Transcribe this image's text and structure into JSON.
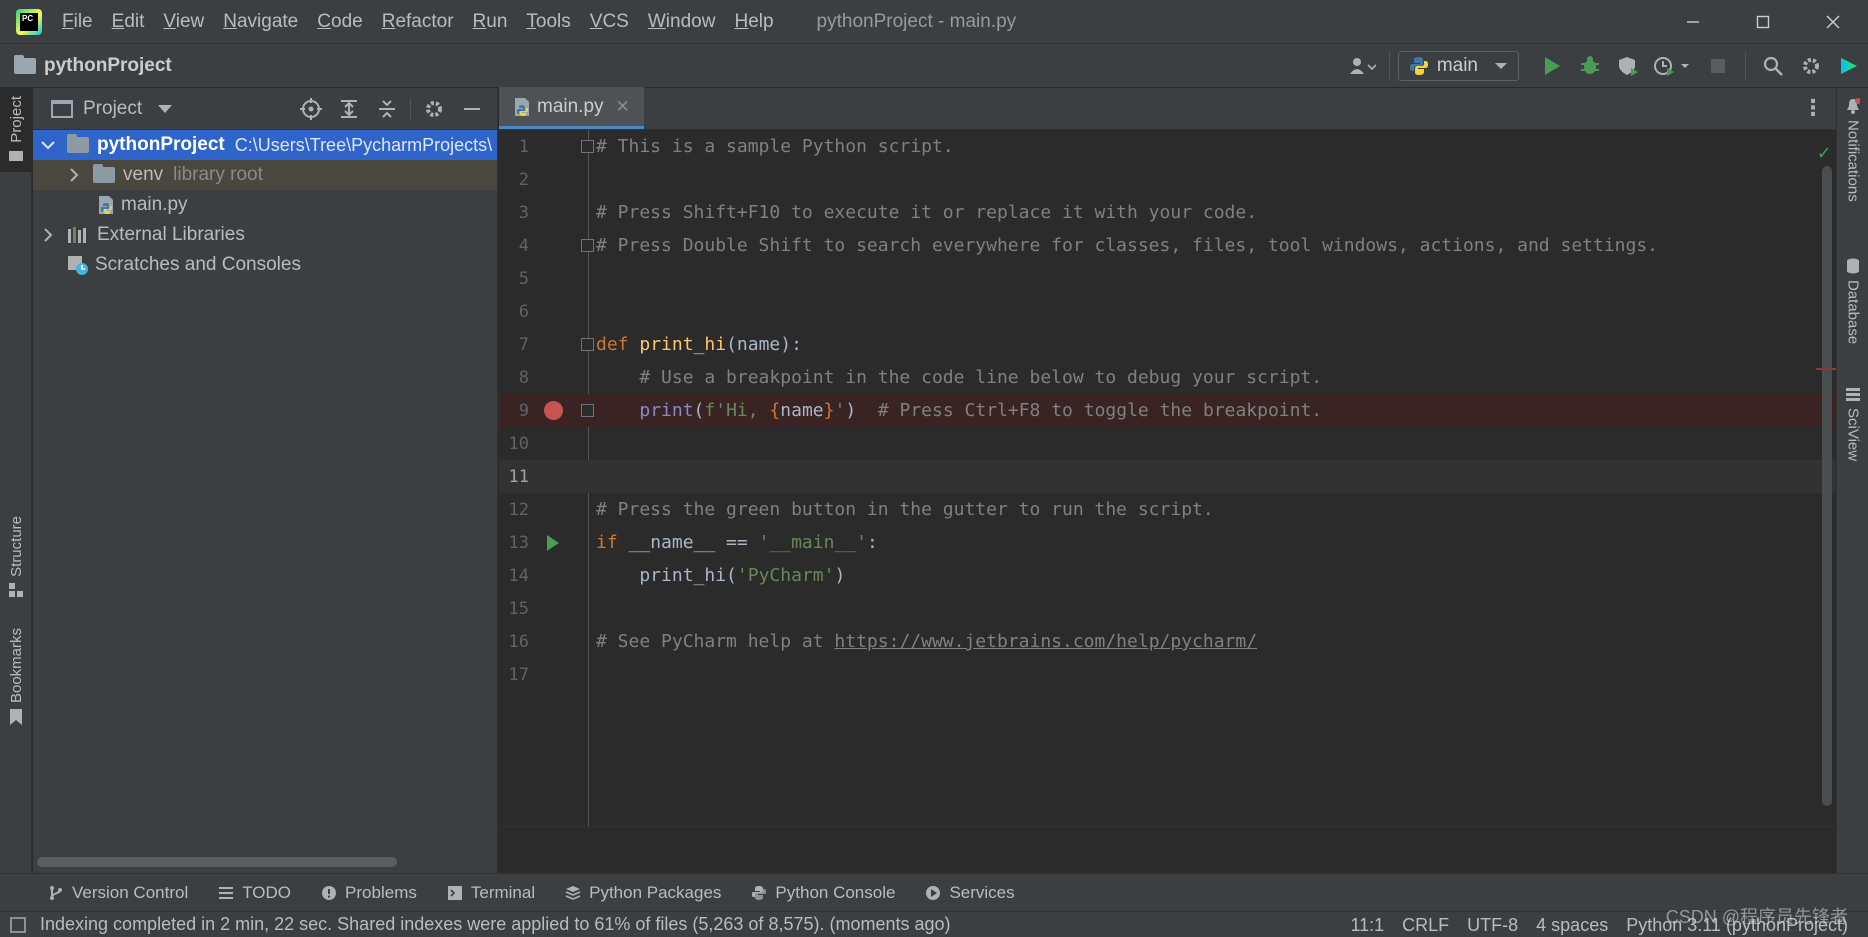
{
  "titlebar": {
    "menus": [
      "File",
      "Edit",
      "View",
      "Navigate",
      "Code",
      "Refactor",
      "Run",
      "Tools",
      "VCS",
      "Window",
      "Help"
    ],
    "window_title": "pythonProject - main.py",
    "logo_text": "PC"
  },
  "navbar": {
    "project": "pythonProject",
    "run_config": "main"
  },
  "left_stripe": {
    "project": "Project",
    "structure": "Structure",
    "bookmarks": "Bookmarks"
  },
  "right_stripe": {
    "notifications": "Notifications",
    "database": "Database",
    "sciview": "SciView"
  },
  "project_panel": {
    "title": "Project",
    "tree": [
      {
        "label": "pythonProject",
        "extra": "C:\\Users\\Tree\\PycharmProjects\\"
      },
      {
        "label": "venv",
        "extra": "library root"
      },
      {
        "label": "main.py"
      },
      {
        "label": "External Libraries"
      },
      {
        "label": "Scratches and Consoles"
      }
    ]
  },
  "editor": {
    "tab": "main.py",
    "lines": [
      {
        "n": "1",
        "text": "# This is a sample Python script."
      },
      {
        "n": "2",
        "text": ""
      },
      {
        "n": "3",
        "text": "# Press Shift+F10 to execute it or replace it with your code."
      },
      {
        "n": "4",
        "text": "# Press Double Shift to search everywhere for classes, files, tool windows, actions, and settings."
      },
      {
        "n": "5",
        "text": ""
      },
      {
        "n": "6",
        "text": ""
      },
      {
        "n": "7",
        "kw": "def",
        "fn": "print_hi",
        "rest": "(name):"
      },
      {
        "n": "8",
        "text": "    # Use a breakpoint in the code line below to debug your script."
      },
      {
        "n": "9",
        "indent": "    ",
        "builtin": "print",
        "p1": "(",
        "s1": "f'Hi, ",
        "b1": "{",
        "var": "name",
        "b2": "}",
        "s2": "'",
        "p2": ")",
        "comment": "  # Press Ctrl+F8 to toggle the breakpoint."
      },
      {
        "n": "10",
        "text": ""
      },
      {
        "n": "11",
        "text": ""
      },
      {
        "n": "12",
        "text": "# Press the green button in the gutter to run the script."
      },
      {
        "n": "13",
        "kw": "if",
        "mid": " __name__ == ",
        "str": "'__main__'",
        "end": ":"
      },
      {
        "n": "14",
        "pre": "    print_hi(",
        "str": "'PyCharm'",
        "end": ")"
      },
      {
        "n": "15",
        "text": ""
      },
      {
        "n": "16",
        "pre": "# See PyCharm help at ",
        "link": "https://www.jetbrains.com/help/pycharm/"
      },
      {
        "n": "17",
        "text": ""
      }
    ]
  },
  "bottom_tools": [
    "Version Control",
    "TODO",
    "Problems",
    "Terminal",
    "Python Packages",
    "Python Console",
    "Services"
  ],
  "statusbar": {
    "message": "Indexing completed in 2 min, 22 sec. Shared indexes were applied to 61% of files (5,263 of 8,575). (moments ago)",
    "position": "11:1",
    "line_sep": "CRLF",
    "encoding": "UTF-8",
    "indent": "4 spaces",
    "interpreter": "Python 3.11 (pythonProject)"
  },
  "watermark": "CSDN @程序员先锋者",
  "colors": {
    "background": "#2b2b2b",
    "panel": "#3c3f41",
    "selection": "#2f65ca",
    "breakpoint": "#c75450",
    "run": "#499c54",
    "keyword": "#cc7832",
    "function": "#ffc66d",
    "string": "#6a8759",
    "comment": "#808080"
  }
}
